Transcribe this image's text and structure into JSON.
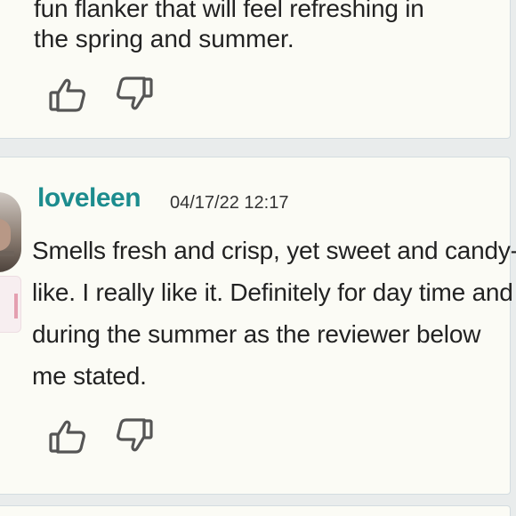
{
  "top_review": {
    "cut_line": "fun flanker that will feel refreshing in",
    "last_line": "the spring and summer.",
    "like_icon": "thumbs-up-icon",
    "dislike_icon": "thumbs-down-icon"
  },
  "review": {
    "username": "loveleen",
    "timestamp": "04/17/22 12:17",
    "text": "Smells fresh and crisp, yet sweet and candy-like. I really like it. Definitely for day time and during the summer as the reviewer below me stated.",
    "avatar": "user-avatar-photo",
    "like_icon": "thumbs-up-icon",
    "dislike_icon": "thumbs-down-icon"
  },
  "colors": {
    "username": "#1c8c8e",
    "card_background": "#fbfbf5",
    "page_background": "#e9ecec",
    "card_border": "#d3dce0",
    "text": "#222222"
  }
}
